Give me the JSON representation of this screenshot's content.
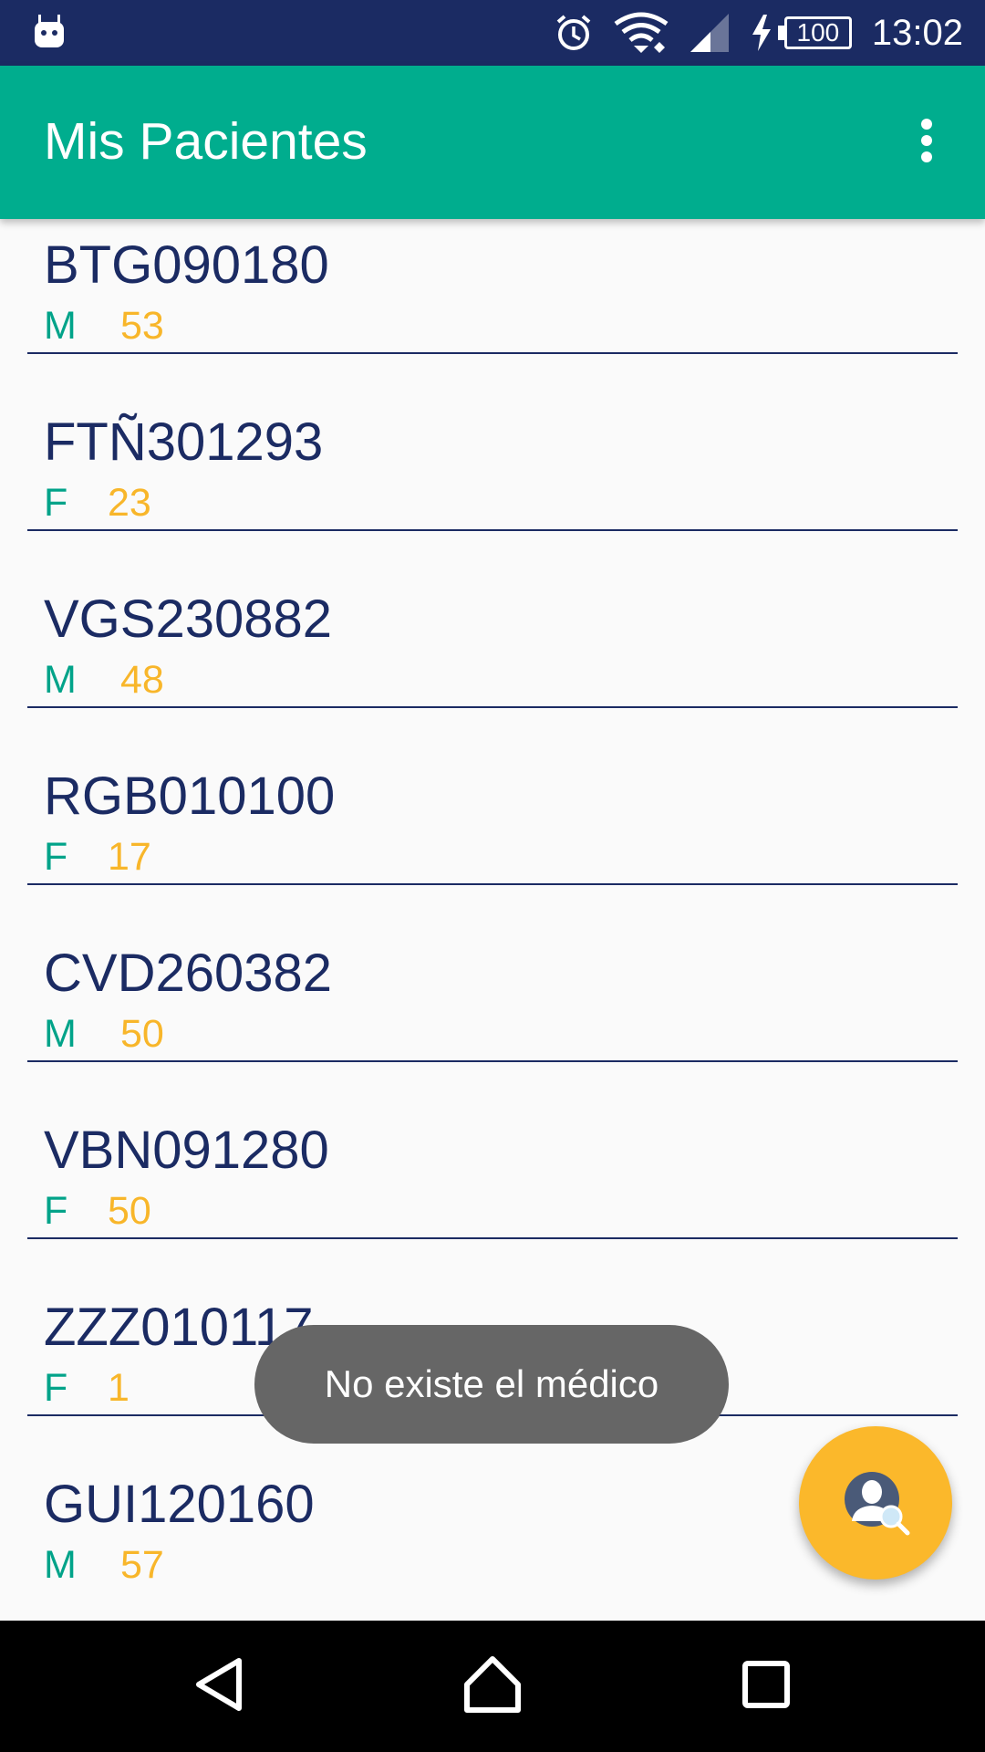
{
  "status_bar": {
    "battery_level": "100",
    "time": "13:02",
    "icons": [
      "android-notification-icon",
      "alarm-icon",
      "wifi-icon",
      "cell-signal-icon",
      "charging-icon",
      "battery-icon"
    ]
  },
  "app_bar": {
    "title": "Mis Pacientes",
    "menu_icon": "overflow-menu-icon"
  },
  "patients": [
    {
      "code": "BTG090180",
      "sex": "M",
      "age": "53"
    },
    {
      "code": "FTÑ301293",
      "sex": "F",
      "age": "23"
    },
    {
      "code": "VGS230882",
      "sex": "M",
      "age": "48"
    },
    {
      "code": "RGB010100",
      "sex": "F",
      "age": "17"
    },
    {
      "code": "CVD260382",
      "sex": "M",
      "age": "50"
    },
    {
      "code": "VBN091280",
      "sex": "F",
      "age": "50"
    },
    {
      "code": "ZZZ010117",
      "sex": "F",
      "age": "1"
    },
    {
      "code": "GUI120160",
      "sex": "M",
      "age": "57"
    }
  ],
  "toast": {
    "message": "No existe el médico"
  },
  "fab": {
    "icon": "search-doctor-icon"
  },
  "nav_bar": {
    "icons": [
      "back-icon",
      "home-icon",
      "recents-icon"
    ]
  },
  "colors": {
    "status_bar": "#1b2b63",
    "app_bar": "#00ad8e",
    "primary_text": "#1b2b63",
    "sex_text": "#00a389",
    "age_text": "#f8b62a",
    "fab": "#fbb82b",
    "toast": "#666666"
  }
}
